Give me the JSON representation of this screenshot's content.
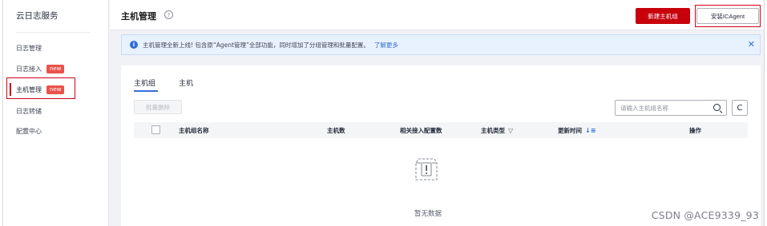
{
  "sidebar": {
    "title": "云日志服务",
    "items": [
      {
        "label": "日志管理",
        "badge": ""
      },
      {
        "label": "日志接入",
        "badge": "new"
      },
      {
        "label": "主机管理",
        "badge": "new"
      },
      {
        "label": "日志转储",
        "badge": ""
      },
      {
        "label": "配置中心",
        "badge": ""
      }
    ]
  },
  "header": {
    "title": "主机管理",
    "help_icon": "question-circle-icon",
    "new_group_label": "新建主机组",
    "install_label": "安装ICAgent"
  },
  "notice": {
    "icon": "info-icon",
    "text": "主机管理全新上线! 包含原“Agent管理”全部功能，同时增加了分组管理和批量配置。",
    "link": "了解更多",
    "close": "✕"
  },
  "tabs": [
    {
      "label": "主机组",
      "active": true
    },
    {
      "label": "主机",
      "active": false
    }
  ],
  "toolbar": {
    "batch_delete_label": "批量删除",
    "search_placeholder": "请输入主机组名称",
    "refresh_icon": "refresh-icon"
  },
  "table": {
    "columns": [
      "主机组名称",
      "主机数",
      "相关接入配置数",
      "主机类型",
      "更新时间",
      "操作"
    ]
  },
  "empty": {
    "text": "暂无数据"
  },
  "watermark": "CSDN @ACE9339_93",
  "colors": {
    "brand_red": "#c7000b",
    "link_blue": "#2f6fd6",
    "badge_red": "#e9524a",
    "notice_bg": "#e8f1fe"
  }
}
